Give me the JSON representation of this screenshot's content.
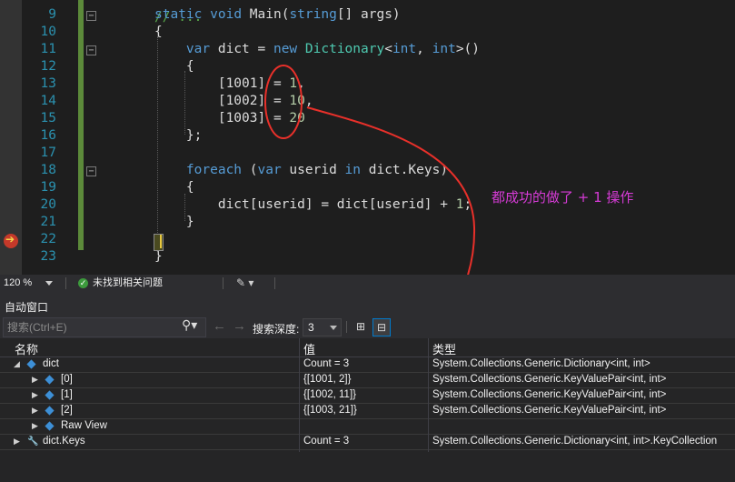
{
  "editor": {
    "lines": [
      {
        "n": "9",
        "html": "<span class=\"kw\">static</span> <span class=\"kw\">void</span> Main(<span class=\"kw\">string</span>[] args)"
      },
      {
        "n": "10",
        "html": "{"
      },
      {
        "n": "11",
        "html": "    <span class=\"kw\">var</span> dict = <span class=\"kw\">new</span> <span class=\"ty\">Dictionary</span>&lt;<span class=\"kw\">int</span>, <span class=\"kw\">int</span>&gt;()"
      },
      {
        "n": "12",
        "html": "    {"
      },
      {
        "n": "13",
        "html": "        [1001] = <span class=\"num\">1</span>,"
      },
      {
        "n": "14",
        "html": "        [1002] = <span class=\"num\">10</span>,"
      },
      {
        "n": "15",
        "html": "        [1003] = <span class=\"num\">20</span>"
      },
      {
        "n": "16",
        "html": "    };"
      },
      {
        "n": "17",
        "html": ""
      },
      {
        "n": "18",
        "html": "    <span class=\"kw\">foreach</span> (<span class=\"kw\">var</span> userid <span class=\"kw\">in</span> dict.Keys)"
      },
      {
        "n": "19",
        "html": "    {"
      },
      {
        "n": "20",
        "html": "        dict[userid] = dict[userid] + <span class=\"num\">1</span>;"
      },
      {
        "n": "21",
        "html": "    }"
      },
      {
        "n": "22",
        "html": ""
      },
      {
        "n": "23",
        "html": "}"
      }
    ],
    "annotation": "都成功的做了 + 1 操作",
    "annotation_color": "#d63bd6",
    "marker_color": "#e8302a"
  },
  "status": {
    "zoom": "120 %",
    "issues": "未找到相关问题"
  },
  "autos": {
    "title": "自动窗口",
    "search_placeholder": "搜索(Ctrl+E)",
    "search_depth_label": "搜索深度:",
    "search_depth_value": "3",
    "columns": {
      "name": "名称",
      "value": "值",
      "type": "类型"
    },
    "rows": [
      {
        "indent": 0,
        "expander": "◢",
        "icon": "cube",
        "name": "dict",
        "value": "Count = 3",
        "type": "System.Collections.Generic.Dictionary<int, int>"
      },
      {
        "indent": 1,
        "expander": "▶",
        "icon": "cube",
        "name": "[0]",
        "value": "{[1001, 2]}",
        "type": "System.Collections.Generic.KeyValuePair<int, int>"
      },
      {
        "indent": 1,
        "expander": "▶",
        "icon": "cube",
        "name": "[1]",
        "value": "{[1002, 11]}",
        "type": "System.Collections.Generic.KeyValuePair<int, int>"
      },
      {
        "indent": 1,
        "expander": "▶",
        "icon": "cube",
        "name": "[2]",
        "value": "{[1003, 21]}",
        "type": "System.Collections.Generic.KeyValuePair<int, int>"
      },
      {
        "indent": 1,
        "expander": "▶",
        "icon": "cube",
        "name": "Raw View",
        "value": "",
        "type": ""
      },
      {
        "indent": 0,
        "expander": "▶",
        "icon": "wrench",
        "name": "dict.Keys",
        "value": "Count = 3",
        "type": "System.Collections.Generic.Dictionary<int, int>.KeyCollection"
      }
    ]
  }
}
